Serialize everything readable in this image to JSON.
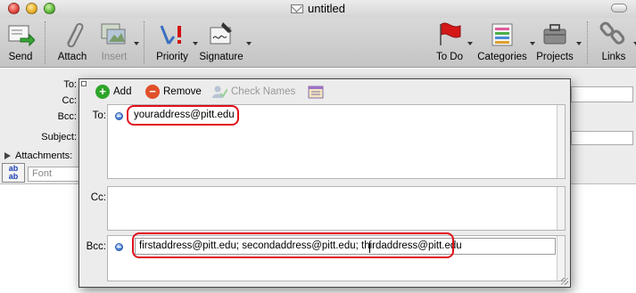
{
  "window": {
    "title": "untitled"
  },
  "toolbar": {
    "send": "Send",
    "attach": "Attach",
    "insert": "Insert",
    "priority": "Priority",
    "signature": "Signature",
    "todo": "To Do",
    "categories": "Categories",
    "projects": "Projects",
    "links": "Links"
  },
  "form": {
    "to_label": "To:",
    "cc_label": "Cc:",
    "bcc_label": "Bcc:",
    "subject_label": "Subject:",
    "attachments_label": "Attachments:",
    "font_placeholder": "Font"
  },
  "popup": {
    "add": "Add",
    "remove": "Remove",
    "check_names": "Check Names",
    "to_label": "To:",
    "cc_label": "Cc:",
    "bcc_label": "Bcc:",
    "to_value": "youraddress@pitt.edu",
    "bcc_value": "firstaddress@pitt.edu; secondaddress@pitt.edu; thirdaddress@pitt.edu"
  },
  "colors": {
    "highlight": "#e0101a",
    "add_green": "#2ea52a",
    "remove_red": "#e0502a",
    "address_dot": "#4a82d6"
  },
  "icons": [
    "send-icon",
    "paperclip-icon",
    "insert-image-icon",
    "priority-icon",
    "signature-icon",
    "flag-icon",
    "categories-icon",
    "projects-icon",
    "links-icon",
    "add-icon",
    "remove-icon",
    "check-names-icon",
    "address-book-icon"
  ]
}
